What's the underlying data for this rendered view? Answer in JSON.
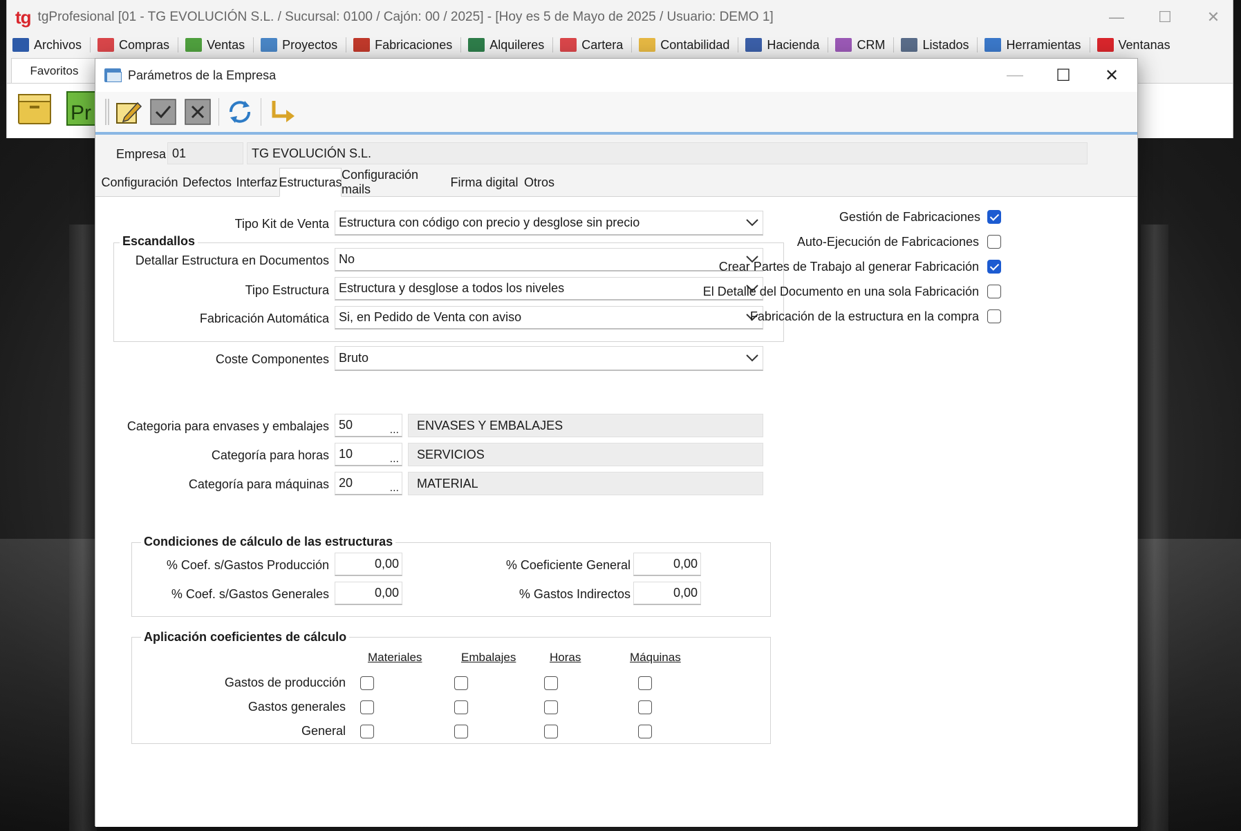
{
  "app": {
    "logo": "tg",
    "title": "tgProfesional [01 - TG EVOLUCIÓN S.L. / Sucursal: 0100 / Cajón: 00 / 2025] - [Hoy es 5 de Mayo de 2025 / Usuario: DEMO 1]",
    "controls": {
      "minimize": "—",
      "maximize": "☐",
      "close": "✕"
    }
  },
  "menu": [
    {
      "label": "Archivos",
      "icon": "archivos-folder-icon",
      "color": "#2d5aa8"
    },
    {
      "label": "Compras",
      "icon": "compras-folder-icon",
      "color": "#d9464a"
    },
    {
      "label": "Ventas",
      "icon": "ventas-folder-icon",
      "color": "#4fa03e"
    },
    {
      "label": "Proyectos",
      "icon": "proyectos-folder-icon",
      "color": "#4a86c6"
    },
    {
      "label": "Fabricaciones",
      "icon": "fabricaciones-factory-icon",
      "color": "#c0392b"
    },
    {
      "label": "Alquileres",
      "icon": "alquileres-folder-icon",
      "color": "#2e7d4a"
    },
    {
      "label": "Cartera",
      "icon": "cartera-folder-icon",
      "color": "#d9464a"
    },
    {
      "label": "Contabilidad",
      "icon": "contabilidad-folder-icon",
      "color": "#e6b843"
    },
    {
      "label": "Hacienda",
      "icon": "hacienda-book-icon",
      "color": "#3b5fa8"
    },
    {
      "label": "CRM",
      "icon": "crm-folder-icon",
      "color": "#9b59b6"
    },
    {
      "label": "Listados",
      "icon": "listados-printer-icon",
      "color": "#5a6d8a"
    },
    {
      "label": "Herramientas",
      "icon": "herramientas-gear-icon",
      "color": "#3b78c9"
    },
    {
      "label": "Ventanas",
      "icon": "ventanas-close-window-icon",
      "color": "#d9262c"
    }
  ],
  "favorites_tab": "Favoritos",
  "dialog": {
    "title": "Parámetros de la Empresa",
    "empresa_label": "Empresa",
    "empresa_code": "01",
    "empresa_name": "TG EVOLUCIÓN S.L.",
    "tabs": [
      {
        "label": "Configuración",
        "active": false
      },
      {
        "label": "Defectos",
        "active": false
      },
      {
        "label": "Interfaz",
        "active": false
      },
      {
        "label": "Estructuras",
        "active": true
      },
      {
        "label": "Configuración mails",
        "active": false
      },
      {
        "label": "Firma digital",
        "active": false
      },
      {
        "label": "Otros",
        "active": false
      }
    ],
    "tipo_kit": {
      "label": "Tipo Kit de Venta",
      "value": "Estructura con código con precio y desglose sin precio"
    },
    "escandallos": {
      "title": "Escandallos",
      "detallar": {
        "label": "Detallar Estructura en Documentos",
        "value": "No"
      },
      "tipo_estructura": {
        "label": "Tipo Estructura",
        "value": "Estructura y desglose a todos los niveles"
      },
      "fabricacion_auto": {
        "label": "Fabricación Automática",
        "value": "Si, en Pedido de Venta con aviso"
      }
    },
    "coste": {
      "label": "Coste Componentes",
      "value": "Bruto"
    },
    "categorias": {
      "envases": {
        "label": "Categoria para envases y embalajes",
        "code": "50",
        "name": "ENVASES Y EMBALAJES"
      },
      "horas": {
        "label": "Categoría para horas",
        "code": "10",
        "name": "SERVICIOS"
      },
      "maquinas": {
        "label": "Categoría para máquinas",
        "code": "20",
        "name": "MATERIAL"
      },
      "lookup": "..."
    },
    "checks": {
      "gestion": {
        "label": "Gestión de Fabricaciones",
        "checked": true
      },
      "autoejec": {
        "label": "Auto-Ejecución de Fabricaciones",
        "checked": false
      },
      "partes": {
        "label": "Crear Partes de Trabajo al generar Fabricación",
        "checked": true
      },
      "detalle": {
        "label": "El Detalle del Documento en una sola Fabricación",
        "checked": false
      },
      "compra": {
        "label": "Fabricación de la estructura en la compra",
        "checked": false
      }
    },
    "condiciones": {
      "title": "Condiciones de cálculo de las estructuras",
      "coef_prod": {
        "label": "% Coef. s/Gastos Producción",
        "value": "0,00"
      },
      "coef_gen": {
        "label": "% Coef. s/Gastos Generales",
        "value": "0,00"
      },
      "coef_general": {
        "label": "% Coeficiente General",
        "value": "0,00"
      },
      "gastos_ind": {
        "label": "% Gastos Indirectos",
        "value": "0,00"
      }
    },
    "aplicacion": {
      "title": "Aplicación coeficientes de cálculo",
      "columns": [
        "Materiales",
        "Embalajes",
        "Horas",
        "Máquinas"
      ],
      "rows": [
        {
          "label": "Gastos de producción",
          "values": [
            false,
            false,
            false,
            false
          ]
        },
        {
          "label": "Gastos generales",
          "values": [
            false,
            false,
            false,
            false
          ]
        },
        {
          "label": "General",
          "values": [
            false,
            false,
            false,
            false
          ]
        }
      ]
    }
  }
}
